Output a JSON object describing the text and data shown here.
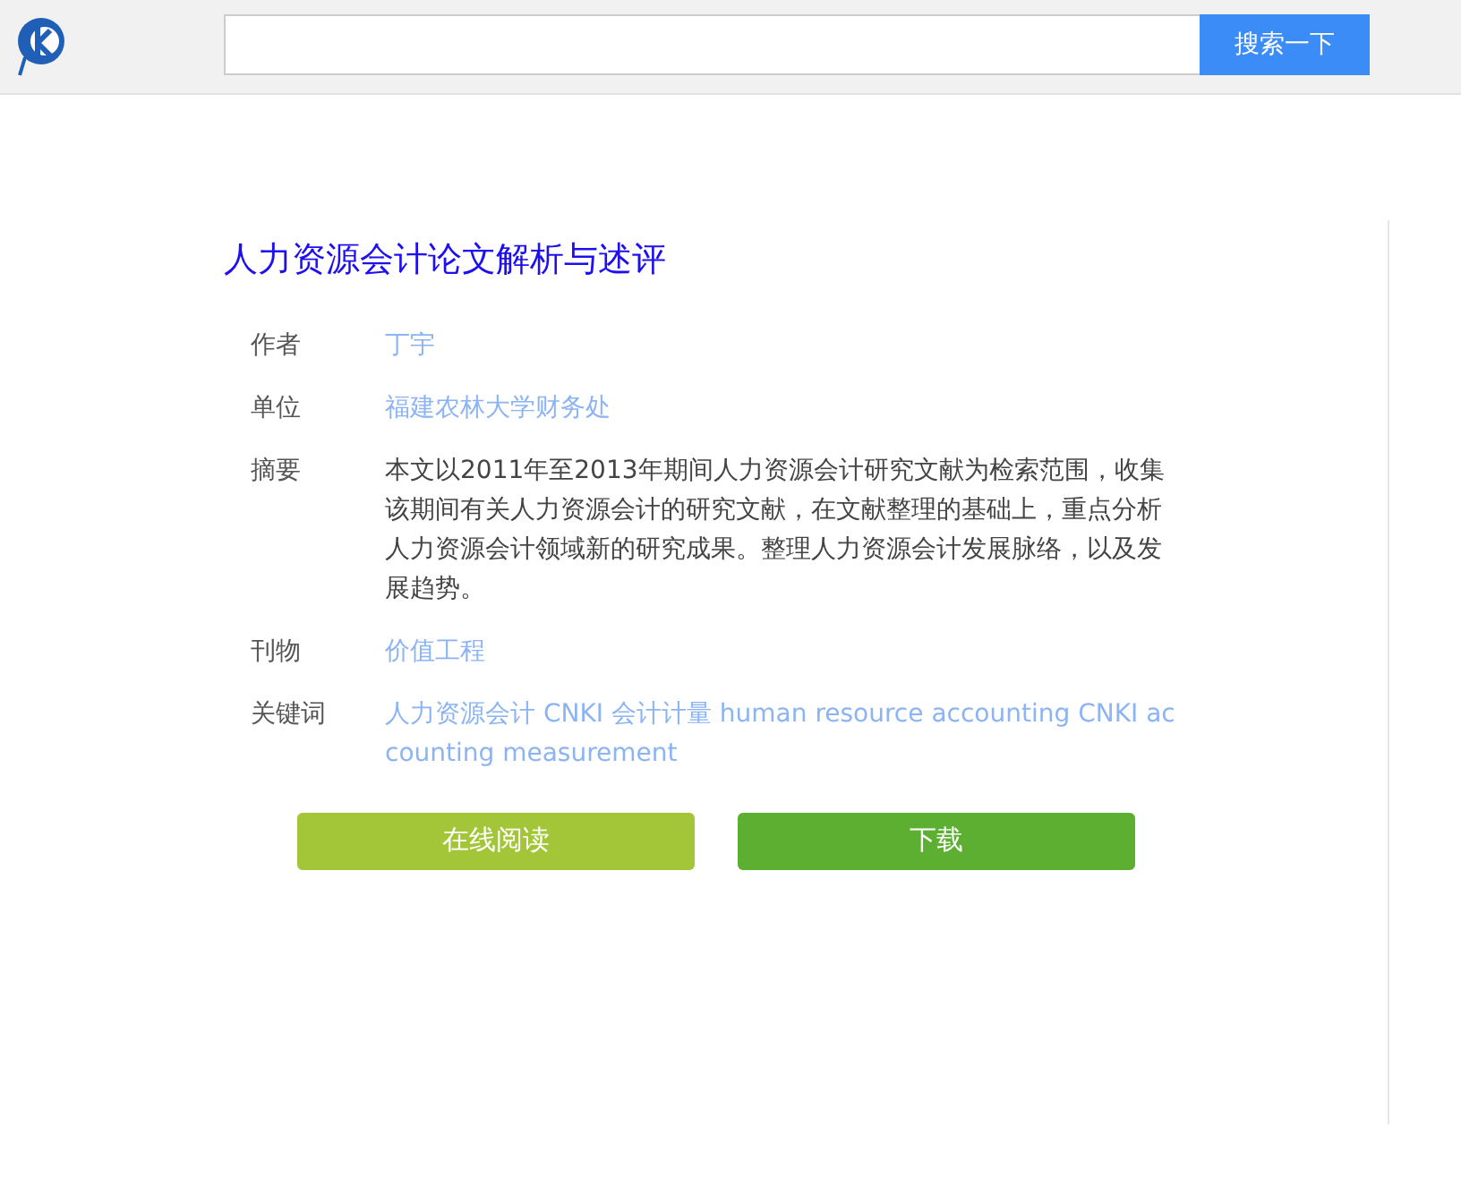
{
  "search": {
    "button": "搜索一下"
  },
  "title": "人力资源会计论文解析与述评",
  "fields": [
    {
      "label": "作者",
      "value": "丁宇",
      "kind": "link"
    },
    {
      "label": "单位",
      "value": "福建农林大学财务处",
      "kind": "link"
    },
    {
      "label": "摘要",
      "value": "本文以2011年至2013年期间人力资源会计研究文献为检索范围，收集该期间有关人力资源会计的研究文献，在文献整理的基础上，重点分析人力资源会计领域新的研究成果。整理人力资源会计发展脉络，以及发展趋势。",
      "kind": "text"
    },
    {
      "label": "刊物",
      "value": "价值工程",
      "kind": "link"
    },
    {
      "label": "关键词",
      "value": "人力资源会计 CNKI 会计计量 human resource accounting CNKI accounting measurement",
      "kind": "link"
    }
  ],
  "buttons": [
    {
      "label": "在线阅读",
      "color": "#a3c638"
    },
    {
      "label": "下载",
      "color": "#5caf30"
    }
  ]
}
